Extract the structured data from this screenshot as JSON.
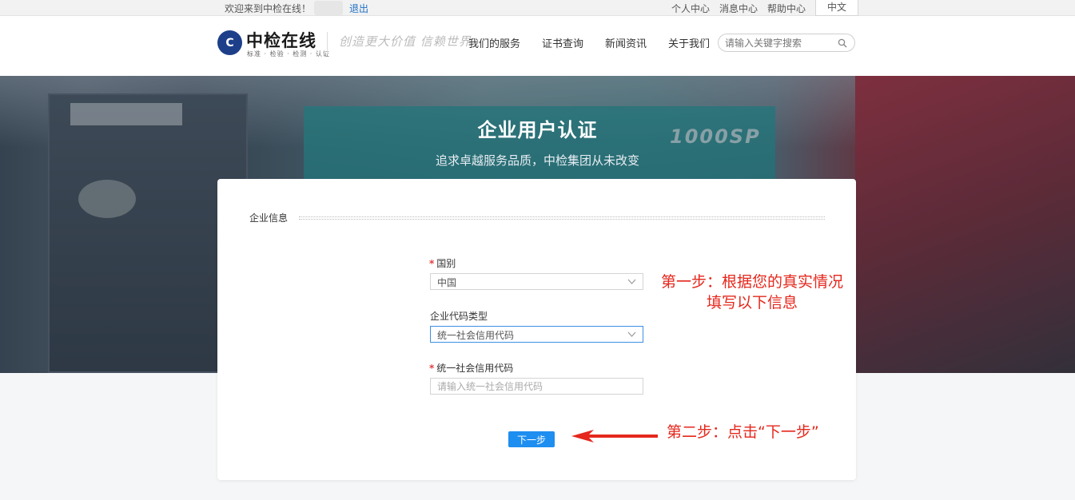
{
  "topbar": {
    "welcome": "欢迎来到中检在线！",
    "logout": "退出",
    "links": [
      "个人中心",
      "消息中心",
      "帮助中心"
    ],
    "language": "中文"
  },
  "header": {
    "logo_mark": "C",
    "logo_text": "中检在线",
    "logo_sub": "标准 · 检验 · 检测 · 认证",
    "slogan": "创造更大价值 信赖世界",
    "nav": [
      "我们的服务",
      "证书查询",
      "新闻资讯",
      "关于我们"
    ],
    "search_placeholder": "请输入关键字搜索"
  },
  "banner": {
    "generator_label": "1000SP",
    "title": "企业用户认证",
    "subtitle": "追求卓越服务品质，中检集团从未改变"
  },
  "form": {
    "section_title": "企业信息",
    "country": {
      "required": "*",
      "label": "国别",
      "value": "中国"
    },
    "code_type": {
      "label": "企业代码类型",
      "value": "统一社会信用代码"
    },
    "credit_code": {
      "required": "*",
      "label": "统一社会信用代码",
      "placeholder": "请输入统一社会信用代码",
      "value": ""
    },
    "next_label": "下一步"
  },
  "annotations": {
    "step1_line1": "第一步：根据您的真实情况",
    "step1_line2": "填写以下信息",
    "step2": "第二步：点击“下一步”"
  },
  "colors": {
    "accent": "#1e8ef0",
    "annotation": "#e5271c",
    "required": "#e23d3d"
  }
}
